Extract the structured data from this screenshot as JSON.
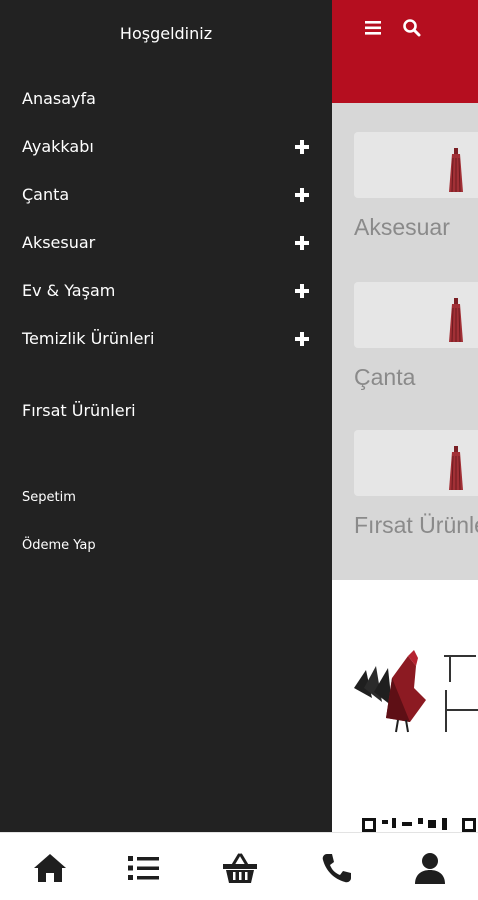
{
  "drawer": {
    "title": "Hoşgeldiniz",
    "menu": [
      {
        "label": "Anasayfa",
        "expandable": false
      },
      {
        "label": "Ayakkabı",
        "expandable": true
      },
      {
        "label": "Çanta",
        "expandable": true
      },
      {
        "label": "Aksesuar",
        "expandable": true
      },
      {
        "label": "Ev & Yaşam",
        "expandable": true
      },
      {
        "label": "Temizlik Ürünleri",
        "expandable": true
      },
      {
        "label": "Fırsat Ürünleri",
        "expandable": false
      }
    ],
    "secondary": [
      {
        "label": "Sepetim"
      },
      {
        "label": "Ödeme Yap"
      }
    ]
  },
  "background": {
    "header_icons": [
      "menu-icon",
      "search-icon"
    ],
    "categories": [
      {
        "label": "Aksesuar"
      },
      {
        "label": "Çanta"
      },
      {
        "label": "Fırsat Ürünle"
      }
    ],
    "accent_color": "#b50e1f"
  },
  "bottom_nav": {
    "icons": [
      "home-icon",
      "list-icon",
      "basket-icon",
      "phone-icon",
      "user-icon"
    ]
  },
  "colors": {
    "drawer_bg": "#222222",
    "header_red": "#b50e1f",
    "icon_dark": "#1e1e1e"
  }
}
